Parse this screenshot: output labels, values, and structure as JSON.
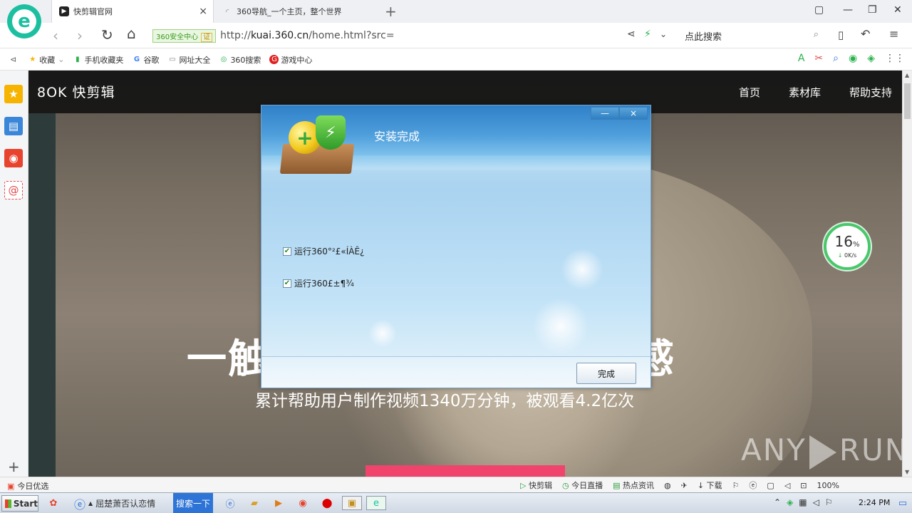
{
  "browser": {
    "tabs": [
      {
        "label": "快剪辑官网",
        "active": true
      },
      {
        "label": "360导航_一个主页，整个世界",
        "active": false
      }
    ],
    "new_tab_symbol": "+",
    "security_badge": "360安全中心",
    "security_cert": "证",
    "url_prefix": "http://",
    "url_host": "kuai.360.cn",
    "url_path": "/home.html?src=",
    "search_placeholder": "点此搜索"
  },
  "bookmarks": [
    {
      "label": "收藏",
      "icon": "star-icon"
    },
    {
      "label": "手机收藏夹",
      "icon": "phone-icon"
    },
    {
      "label": "谷歌",
      "icon": "google-icon"
    },
    {
      "label": "网址大全",
      "icon": "page-icon"
    },
    {
      "label": "360搜索",
      "icon": "search-360-icon"
    },
    {
      "label": "游戏中心",
      "icon": "game-icon"
    }
  ],
  "site": {
    "logo": "8OK 快剪辑",
    "nav": [
      "首页",
      "素材库",
      "帮助支持"
    ],
    "hero_title_left": "一触",
    "hero_title_right": "灵感",
    "hero_subtitle": "累计帮助用户制作视频1340万分钟，被观看4.2亿次",
    "watermark_left": "ANY",
    "watermark_right": "RUN"
  },
  "speed_widget": {
    "percent": "16",
    "percent_unit": "%",
    "rate": "0K/s"
  },
  "dialog": {
    "title": "安装完成",
    "options": [
      {
        "label": "运行360°²£«ÍÀÊ¿",
        "checked": true
      },
      {
        "label": "运行360£±¶¾",
        "checked": true
      }
    ],
    "done_button": "完成",
    "minimize_symbol": "—",
    "close_symbol": "×"
  },
  "statusbar": {
    "left_label": "今日优选",
    "right_items": [
      "快剪辑",
      "今日直播",
      "热点资讯",
      "下载"
    ],
    "zoom": "100%"
  },
  "taskbar": {
    "start_label": "Start",
    "ie_label": "屈楚萧否认恋情",
    "search_button": "搜索一下",
    "clock": "2:24 PM"
  },
  "colors": {
    "brand_360": "#1cc0a0",
    "dialog_header": "#2f80c8",
    "pink_bar": "#f0446d",
    "speed_ring": "#49c76b"
  }
}
